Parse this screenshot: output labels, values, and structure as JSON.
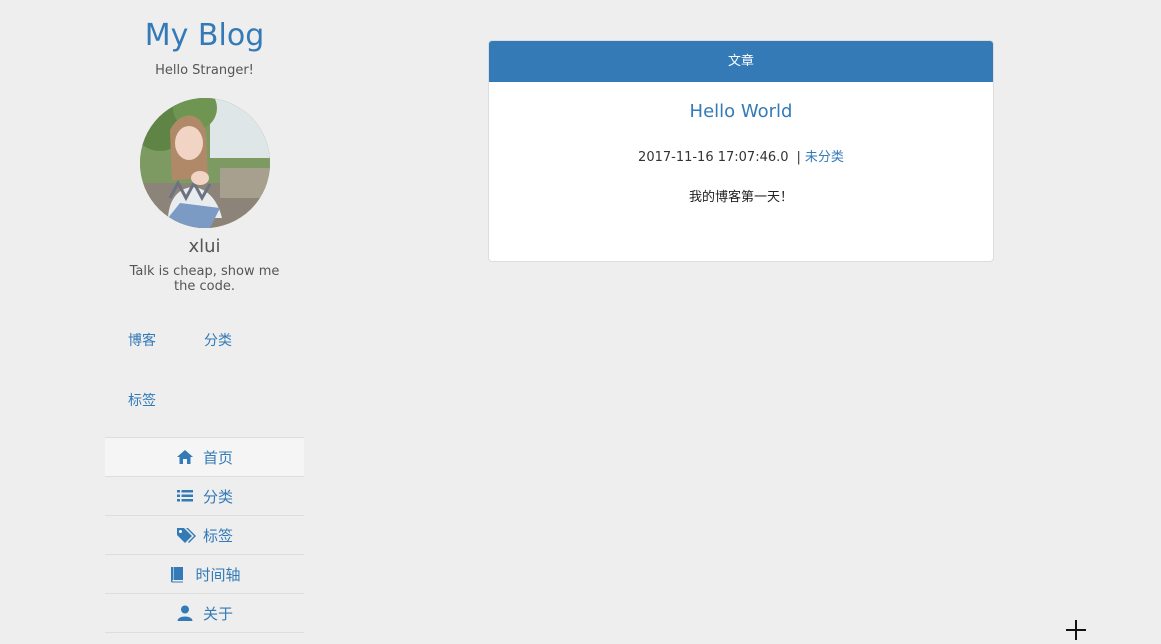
{
  "sidebar": {
    "blog_title": "My Blog",
    "subtitle": "Hello Stranger!",
    "username": "xlui",
    "motto": "Talk is cheap, show me the code.",
    "stats": {
      "blog": "博客",
      "category": "分类",
      "tag": "标签"
    },
    "nav": [
      {
        "label": "首页",
        "icon": "home-icon",
        "active": true
      },
      {
        "label": "分类",
        "icon": "list-icon",
        "active": false
      },
      {
        "label": "标签",
        "icon": "tags-icon",
        "active": false
      },
      {
        "label": "时间轴",
        "icon": "book-icon",
        "active": false
      },
      {
        "label": "关于",
        "icon": "user-icon",
        "active": false
      }
    ]
  },
  "main": {
    "panel_heading": "文章",
    "post": {
      "title": "Hello World",
      "date": "2017-11-16 17:07:46.0",
      "separator": "|",
      "category": "未分类",
      "excerpt": "我的博客第一天！"
    }
  },
  "colors": {
    "accent": "#337ab7",
    "background": "#eeeeee",
    "panel": "#ffffff"
  }
}
